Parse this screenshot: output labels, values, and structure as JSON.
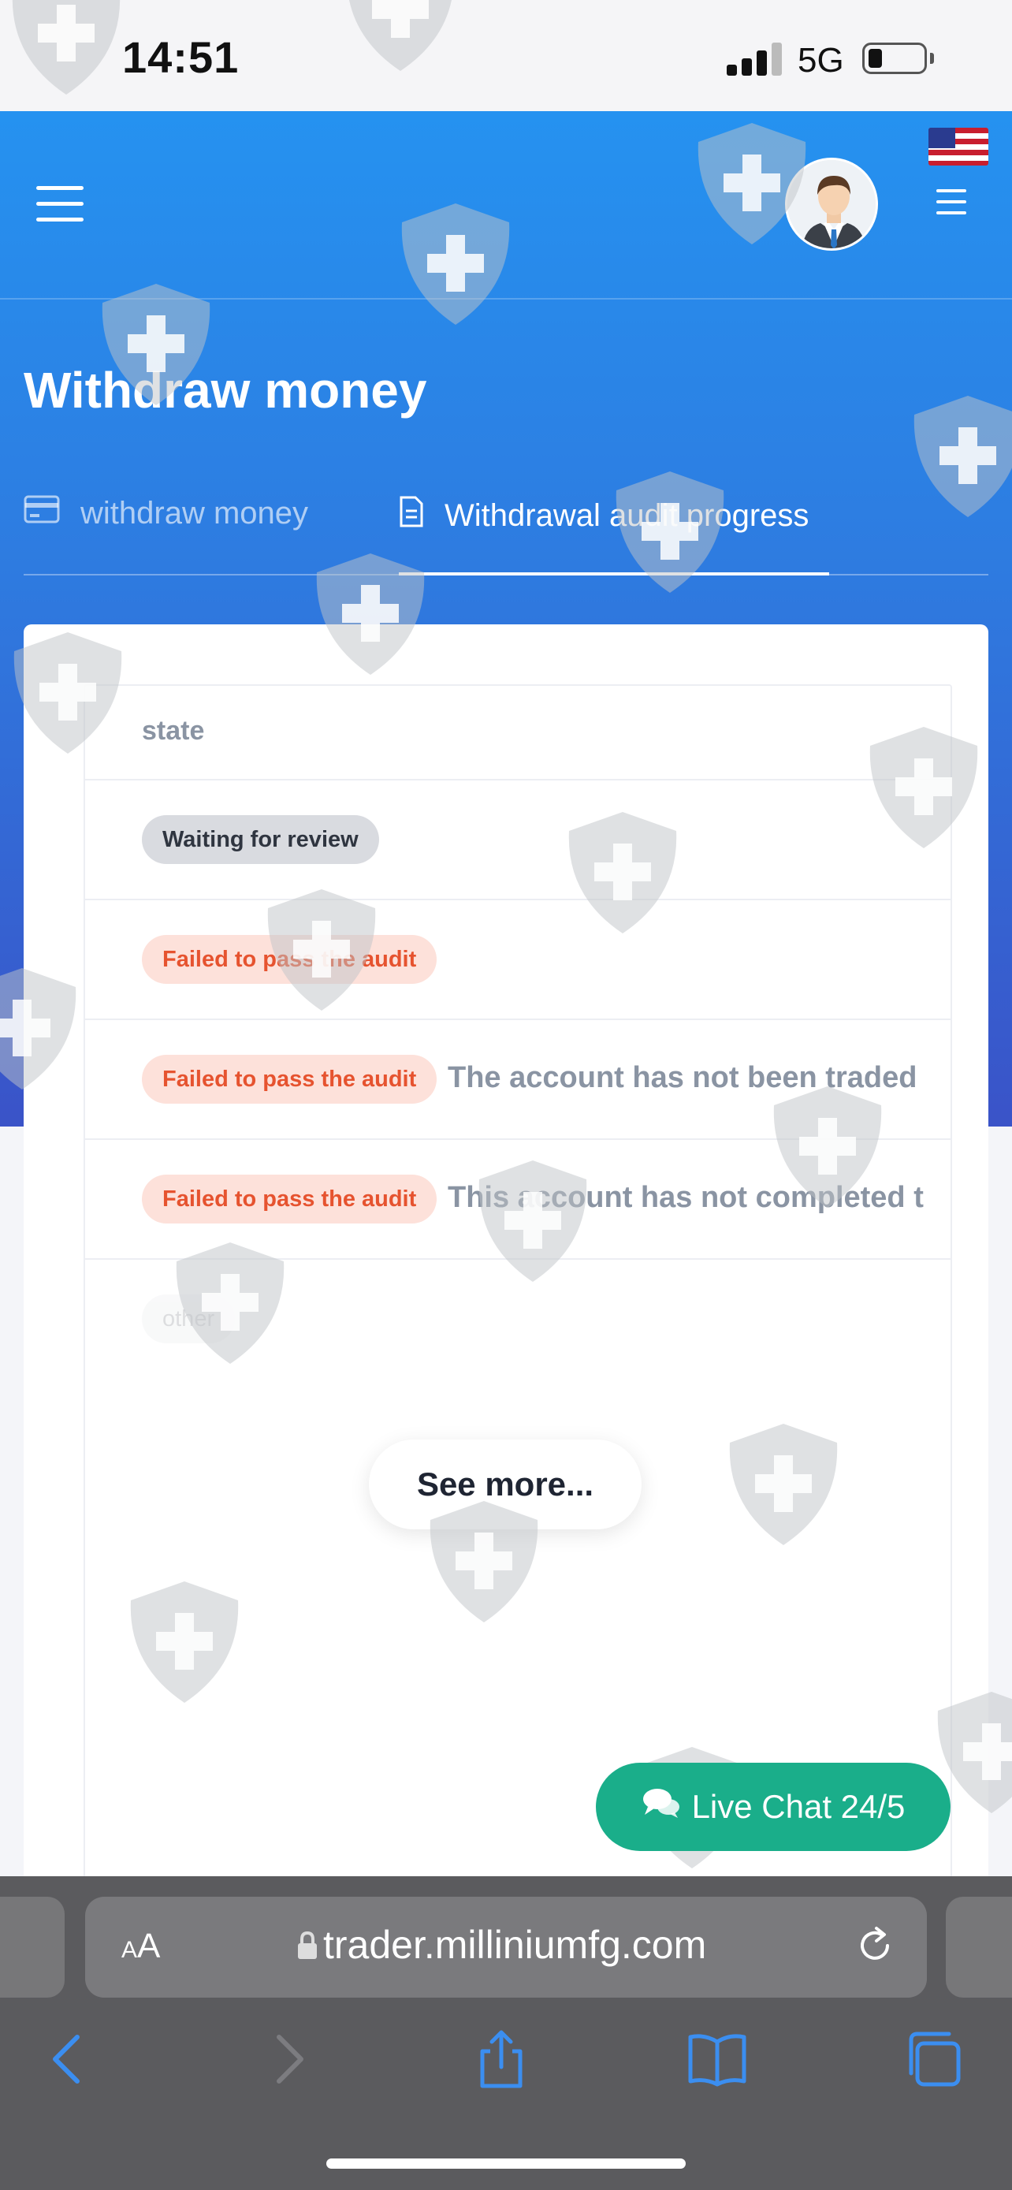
{
  "status_bar": {
    "time": "14:51",
    "network": "5G"
  },
  "header": {
    "page_title": "Withdraw money",
    "tabs": [
      {
        "label": "withdraw money",
        "active": false
      },
      {
        "label": "Withdrawal audit progress",
        "active": true
      }
    ]
  },
  "table": {
    "header": "state",
    "rows": [
      {
        "status": "Waiting for review",
        "remark": ""
      },
      {
        "status": "Failed to pass the audit",
        "remark": ""
      },
      {
        "status": "Failed to pass the audit",
        "remark": "The account has not been traded"
      },
      {
        "status": "Failed to pass the audit",
        "remark": "This account has not completed t"
      }
    ],
    "faded_row_badge": "other"
  },
  "buttons": {
    "see_more": "See more...",
    "live_chat": "Live Chat 24/5"
  },
  "browser": {
    "text_size_label_small": "A",
    "text_size_label_large": "A",
    "url": "trader.milliniumfg.com"
  },
  "colors": {
    "header_top": "#2592f0",
    "header_bottom": "#3a53c8",
    "badge_red_text": "#e6532f",
    "badge_red_bg": "#fde1da",
    "live_chat": "#1aae8a"
  }
}
